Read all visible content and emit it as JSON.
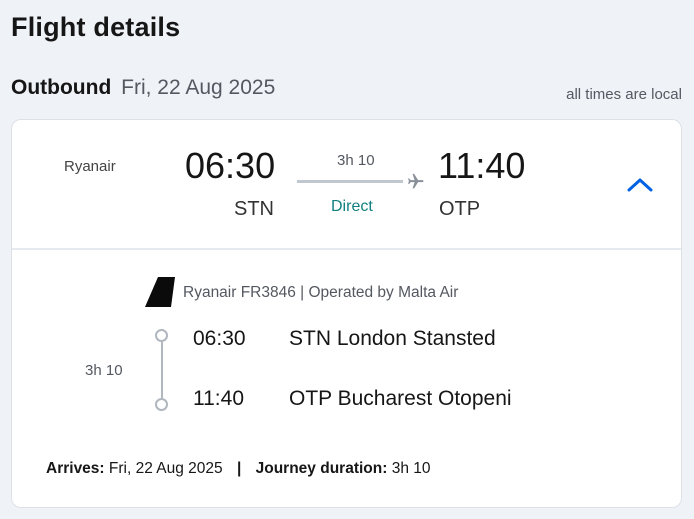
{
  "page": {
    "title": "Flight details"
  },
  "leg": {
    "label": "Outbound",
    "date": "Fri, 22 Aug 2025",
    "times_note": "all times are local"
  },
  "summary": {
    "airline": "Ryanair",
    "departure_time": "06:30",
    "departure_code": "STN",
    "arrival_time": "11:40",
    "arrival_code": "OTP",
    "duration": "3h 10",
    "stops": "Direct"
  },
  "segment": {
    "carrier_info": "Ryanair FR3846 | Operated by Malta Air",
    "duration": "3h 10",
    "departure": {
      "time": "06:30",
      "place": "STN London Stansted"
    },
    "arrival": {
      "time": "11:40",
      "place": "OTP Bucharest Otopeni"
    }
  },
  "footer": {
    "arrives_label": "Arrives:",
    "arrives_value": "Fri, 22 Aug 2025",
    "separator": "|",
    "journey_label": "Journey duration:",
    "journey_value": "3h 10"
  },
  "colors": {
    "accent": "#0062e3",
    "direct_text": "#137f7f",
    "background": "#eff3f8"
  },
  "icons": {
    "plane": "plane-icon",
    "chevron": "chevron-up-icon",
    "airline_logo": "airline-tail-icon"
  }
}
